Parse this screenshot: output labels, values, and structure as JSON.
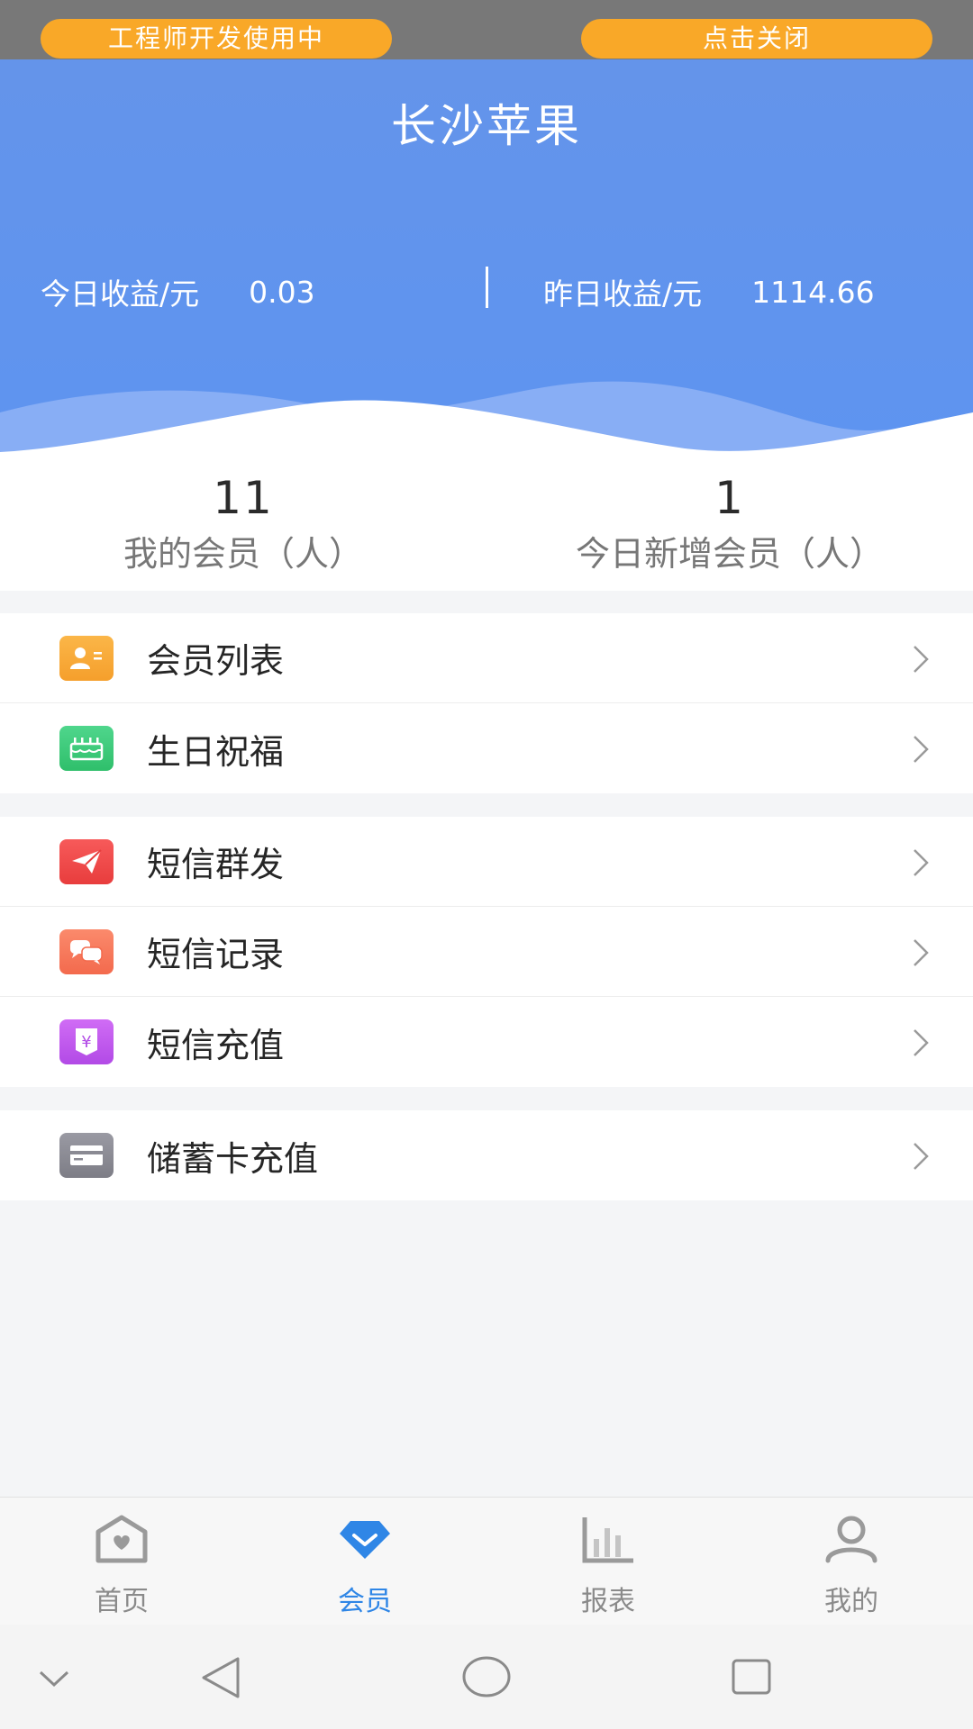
{
  "dev_banner": {
    "status_label": "工程师开发使用中",
    "close_label": "点击关闭"
  },
  "header": {
    "title": "长沙苹果",
    "today_label": "今日收益/元",
    "today_value": "0.03",
    "yesterday_label": "昨日收益/元",
    "yesterday_value": "1114.66"
  },
  "stats": {
    "members_count": "11",
    "members_label": "我的会员（人）",
    "new_members_count": "1",
    "new_members_label": "今日新增会员（人）"
  },
  "menu": {
    "member_list": "会员列表",
    "birthday": "生日祝福",
    "sms_bulk": "短信群发",
    "sms_records": "短信记录",
    "sms_recharge": "短信充值",
    "card_recharge": "储蓄卡充值",
    "yuan_symbol": "¥"
  },
  "tabs": [
    {
      "label": "首页"
    },
    {
      "label": "会员"
    },
    {
      "label": "报表"
    },
    {
      "label": "我的"
    }
  ],
  "colors": {
    "header_blue": "#6494ea",
    "banner_orange": "#f9a828",
    "active_tab": "#2f86e6"
  }
}
